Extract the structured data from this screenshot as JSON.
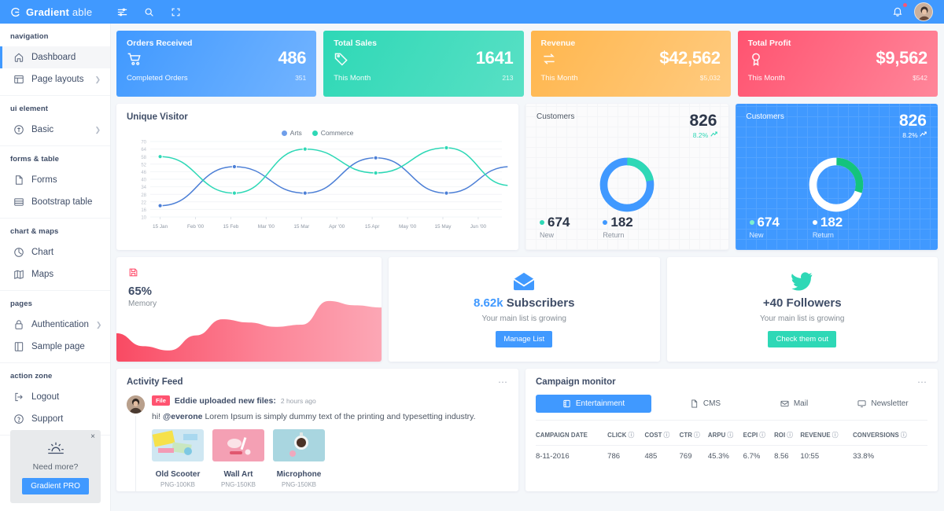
{
  "header": {
    "brand_bold": "Gradient",
    "brand_light": " able",
    "icons": [
      "menu-icon",
      "search-icon",
      "fullscreen-icon",
      "bell-icon",
      "avatar"
    ]
  },
  "sidebar": {
    "sections": [
      {
        "caption": "navigation",
        "items": [
          {
            "label": "Dashboard",
            "icon": "home-icon",
            "active": true,
            "chevron": false
          },
          {
            "label": "Page layouts",
            "icon": "layout-icon",
            "active": false,
            "chevron": true
          }
        ]
      },
      {
        "caption": "ui element",
        "items": [
          {
            "label": "Basic",
            "icon": "circle-icon",
            "active": false,
            "chevron": true
          }
        ]
      },
      {
        "caption": "forms & table",
        "items": [
          {
            "label": "Forms",
            "icon": "file-icon",
            "active": false,
            "chevron": false
          },
          {
            "label": "Bootstrap table",
            "icon": "table-icon",
            "active": false,
            "chevron": false
          }
        ]
      },
      {
        "caption": "chart & maps",
        "items": [
          {
            "label": "Chart",
            "icon": "pie-icon",
            "active": false,
            "chevron": false
          },
          {
            "label": "Maps",
            "icon": "map-icon",
            "active": false,
            "chevron": false
          }
        ]
      },
      {
        "caption": "pages",
        "items": [
          {
            "label": "Authentication",
            "icon": "lock-icon",
            "active": false,
            "chevron": true
          },
          {
            "label": "Sample page",
            "icon": "page-icon",
            "active": false,
            "chevron": false
          }
        ]
      },
      {
        "caption": "action zone",
        "items": [
          {
            "label": "Logout",
            "icon": "logout-icon",
            "active": false,
            "chevron": false
          },
          {
            "label": "Support",
            "icon": "help-icon",
            "active": false,
            "chevron": false
          }
        ]
      }
    ],
    "promo": {
      "title": "Need more?",
      "button": "Gradient PRO",
      "close": "×",
      "icon": "sunrise-icon"
    }
  },
  "stats": [
    {
      "title": "Orders Received",
      "value": "486",
      "foot_label": "Completed Orders",
      "foot_value": "351",
      "icon": "cart-icon",
      "color": "#4099ff"
    },
    {
      "title": "Total Sales",
      "value": "1641",
      "foot_label": "This Month",
      "foot_value": "213",
      "icon": "tag-icon",
      "color": "#2ed8b6"
    },
    {
      "title": "Revenue",
      "value": "$42,562",
      "foot_label": "This Month",
      "foot_value": "$5,032",
      "icon": "exchange-icon",
      "color": "#FFB64D"
    },
    {
      "title": "Total Profit",
      "value": "$9,562",
      "foot_label": "This Month",
      "foot_value": "$542",
      "icon": "award-icon",
      "color": "#FF5370"
    }
  ],
  "unique_visitor": {
    "title": "Unique Visitor"
  },
  "customers": [
    {
      "title": "Customers",
      "total": "826",
      "pct": "8.2%",
      "trend_icon": "trend-up-icon",
      "new_value": "674",
      "new_label": "New",
      "return_value": "182",
      "return_label": "Return",
      "theme": "white",
      "new_color": "#2ed8b6",
      "return_color": "#4099ff"
    },
    {
      "title": "Customers",
      "total": "826",
      "pct": "8.2%",
      "trend_icon": "trend-up-icon",
      "new_value": "674",
      "new_label": "New",
      "return_value": "182",
      "return_label": "Return",
      "theme": "blue",
      "new_color": "#2ed8b6",
      "return_color": "#ffffff"
    }
  ],
  "memory": {
    "pct": "65%",
    "label": "Memory",
    "icon": "save-icon",
    "color": "#FF5370"
  },
  "social": [
    {
      "count": "8.62k",
      "noun": " Subscribers",
      "sub": "Your main list is growing",
      "button": "Manage List",
      "icon": "envelope-icon",
      "color": "#4099ff"
    },
    {
      "count": "+40",
      "noun": " Followers",
      "sub": "Your main list is growing",
      "button": "Check them out",
      "icon": "twitter-icon",
      "color": "#2ed8b6"
    }
  ],
  "activity_feed": {
    "title": "Activity Feed",
    "menu_icon": "ellipsis-icon",
    "badge": "File",
    "actor_line": "Eddie uploaded new files:",
    "time": "2 hours ago",
    "message_pre": "hi! ",
    "mention": "@everone",
    "message_post": " Lorem Ipsum is simply dummy text of the printing and typesetting industry.",
    "thumbs": [
      {
        "name": "Old Scooter",
        "meta": "PNG-100KB"
      },
      {
        "name": "Wall Art",
        "meta": "PNG-150KB"
      },
      {
        "name": "Microphone",
        "meta": "PNG-150KB"
      }
    ]
  },
  "campaign_monitor": {
    "title": "Campaign monitor",
    "menu_icon": "ellipsis-icon",
    "tabs": [
      {
        "label": "Entertainment",
        "icon": "film-icon",
        "active": true
      },
      {
        "label": "CMS",
        "icon": "file-icon",
        "active": false
      },
      {
        "label": "Mail",
        "icon": "mail-icon",
        "active": false
      },
      {
        "label": "Newsletter",
        "icon": "monitor-icon",
        "active": false
      }
    ],
    "columns": [
      "CAMPAIGN DATE",
      "CLICK",
      "COST",
      "CTR",
      "ARPU",
      "ECPI",
      "ROI",
      "REVENUE",
      "CONVERSIONS"
    ],
    "help_icon": "question-circle-icon",
    "rows": [
      {
        "date": "8-11-2016",
        "cells": [
          {
            "value": "786",
            "bar_pct": 72,
            "bar_color": "#e4546d"
          },
          {
            "value": "485",
            "bar_pct": 65,
            "bar_color": "#4680ab"
          },
          {
            "value": "769",
            "bar_pct": 70,
            "bar_color": "#f0c070"
          },
          {
            "value": "45.3%",
            "bar_pct": 72,
            "bar_color": "#2ed8b6"
          },
          {
            "value": "6.7%",
            "bar_pct": 38,
            "bar_color": "#17b6c4"
          },
          {
            "value": "8.56",
            "bar_pct": 45,
            "bar_color": "#e4546d"
          },
          {
            "value": "10:55",
            "bar_pct": 85,
            "bar_color": "#f0c070"
          },
          {
            "value": "33.8%",
            "bar_pct": 80,
            "bar_color": "#2ed8b6"
          }
        ]
      }
    ]
  },
  "chart_data": [
    {
      "type": "line",
      "title": "Unique Visitor",
      "xlabel": "",
      "ylabel": "",
      "ylim": [
        10,
        70
      ],
      "yticks": [
        10,
        16,
        22,
        28,
        34,
        40,
        46,
        52,
        58,
        64,
        70
      ],
      "grid": true,
      "legend_position": "top-center",
      "categories": [
        "15 Jan",
        "Feb '00",
        "15 Feb",
        "Mar '00",
        "15 Mar",
        "Apr '00",
        "15 Apr",
        "May '00",
        "15 May",
        "Jun '00"
      ],
      "series": [
        {
          "name": "Arts",
          "color": "#4c7fd6",
          "markers_x": [
            0,
            2.1,
            4.1,
            6.1,
            8.1,
            9.9
          ],
          "values": [
            19,
            50,
            29,
            57,
            29,
            50
          ]
        },
        {
          "name": "Commerce",
          "color": "#2ed8b6",
          "markers_x": [
            0,
            2.1,
            4.1,
            6.1,
            8.1,
            9.9
          ],
          "values": [
            58,
            29,
            64,
            45,
            65,
            35
          ]
        }
      ]
    },
    {
      "type": "pie",
      "title": "Customers",
      "variant": "donut",
      "total": 826,
      "labels": [
        "New",
        "Return"
      ],
      "values": [
        674,
        182
      ],
      "colors": [
        "#2ed8b6",
        "#4099ff"
      ],
      "note": "left card: blue arc dominant, green arc ~22% starting at top"
    },
    {
      "type": "pie",
      "title": "Customers",
      "variant": "donut",
      "total": 826,
      "labels": [
        "New",
        "Return"
      ],
      "values": [
        674,
        182
      ],
      "colors": [
        "#2ed8b6",
        "#ffffff"
      ],
      "note": "right card on blue background: white arc dominant, green arc ~30%"
    },
    {
      "type": "area",
      "title": "Memory",
      "value_label": "65%",
      "color": "#FF5370",
      "x": [
        0,
        1,
        2,
        3,
        4,
        5,
        6,
        7,
        8,
        9,
        10
      ],
      "values": [
        42,
        30,
        26,
        40,
        55,
        52,
        48,
        50,
        72,
        68,
        66
      ]
    }
  ]
}
